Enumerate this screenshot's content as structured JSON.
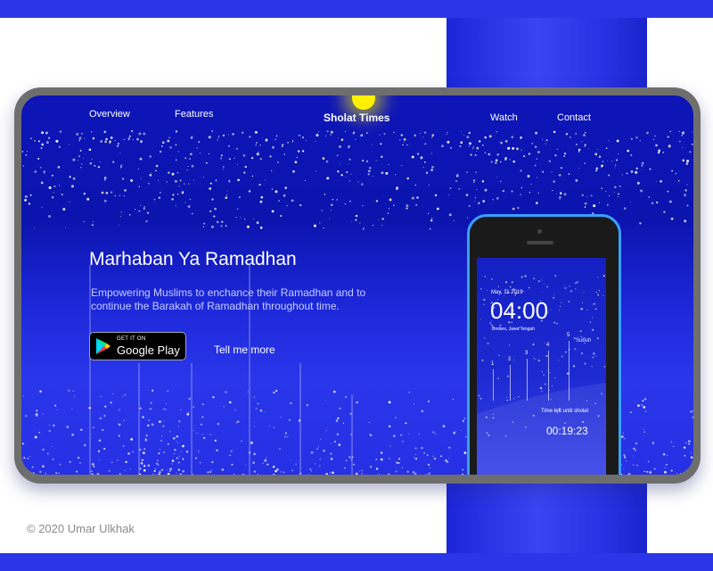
{
  "nav": {
    "overview": "Overview",
    "features": "Features",
    "brand": "Sholat Times",
    "watch": "Watch",
    "contact": "Contact"
  },
  "hero": {
    "title": "Marhaban Ya Ramadhan",
    "subtitle": "Empowering Muslims to enchance their Ramadhan and to continue the Barakah of Ramadhan throughout time.",
    "store_small": "GET IT ON",
    "store_big": "Google Play",
    "tell_more": "Tell me more"
  },
  "phone": {
    "date": "May, 11 2019",
    "time": "04:00",
    "location": "Brebes, Jawa Tengah",
    "next_prayer": "Subuh",
    "markers": [
      "1",
      "2",
      "3",
      "4",
      "5"
    ],
    "caption": "Time left until sholat",
    "countdown": "00:19:23"
  },
  "footer": {
    "copyright": "© 2020 Umar Ulkhak"
  },
  "colors": {
    "band": "#2c36e8",
    "sky_top": "#0d15b8",
    "sky_bottom": "#2630e4",
    "phone_rim": "#3aa0ff",
    "sun": "#fff100"
  },
  "icons": [
    "google-play-icon",
    "sun-icon",
    "stars-decoration"
  ]
}
